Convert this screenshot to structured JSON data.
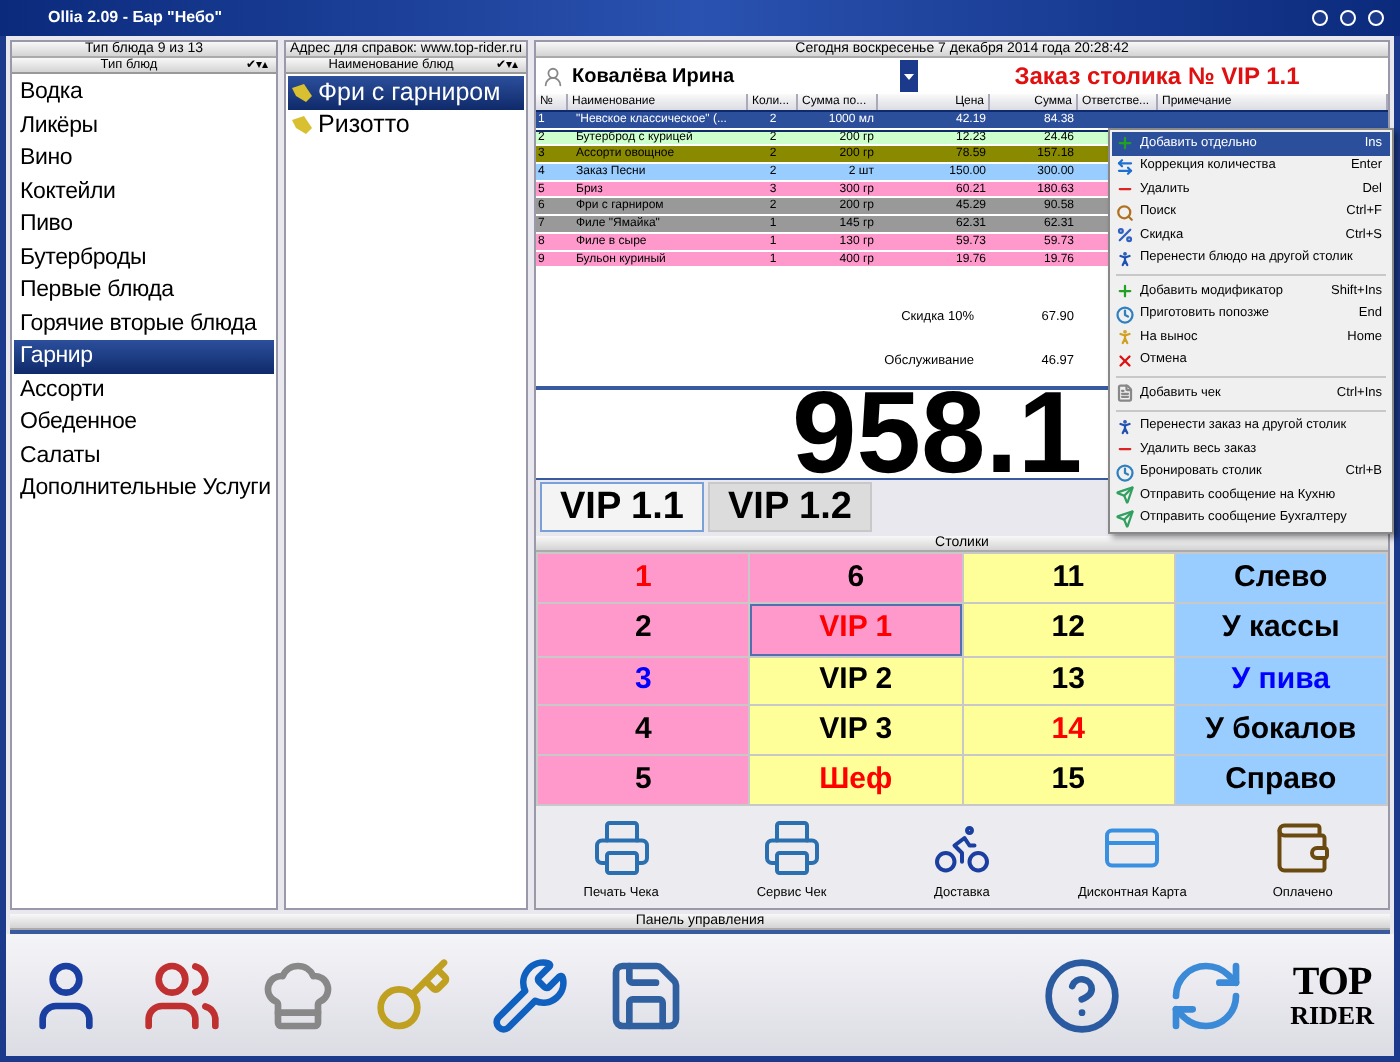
{
  "window": {
    "title": "Ollia 2.09 - Бар \"Небо\""
  },
  "dish_types": {
    "caption": "Тип блюда 9 из 13",
    "header": "Тип блюд",
    "header_marks": "✔▾▴",
    "items": [
      {
        "label": "Водка",
        "selected": false
      },
      {
        "label": "Ликёры",
        "selected": false
      },
      {
        "label": "Вино",
        "selected": false
      },
      {
        "label": "Коктейли",
        "selected": false
      },
      {
        "label": "Пиво",
        "selected": false
      },
      {
        "label": "Бутерброды",
        "selected": false
      },
      {
        "label": "Первые блюда",
        "selected": false
      },
      {
        "label": "Горячие вторые блюда",
        "selected": false
      },
      {
        "label": "Гарнир",
        "selected": true
      },
      {
        "label": "Ассорти",
        "selected": false
      },
      {
        "label": "Обеденное",
        "selected": false
      },
      {
        "label": "Салаты",
        "selected": false
      },
      {
        "label": "Дополнительные Услуги",
        "selected": false
      }
    ]
  },
  "dishes": {
    "caption": "Адрес для справок: www.top-rider.ru",
    "header": "Наименование блюд",
    "header_marks": "✔▾▴",
    "items": [
      {
        "label": "Фри с гарниром",
        "selected": true
      },
      {
        "label": "Ризотто",
        "selected": false
      }
    ]
  },
  "date_line": "Сегодня  воскресенье  7 декабря 2014 года  20:28:42",
  "customer": "Ковалёва Ирина",
  "order_title": "Заказ столика № VIP 1.1",
  "order_table": {
    "columns": [
      "№",
      "Наименование",
      "Коли...",
      "Сумма по...",
      "Цена",
      "Сумма",
      "Ответстве...",
      "Примечание"
    ],
    "rows": [
      {
        "cells": [
          "1",
          "\"Невское классическое\" (...",
          "2",
          "1000 мл",
          "42.19",
          "84.38"
        ],
        "color": "#2c4f9c",
        "selected": true
      },
      {
        "cells": [
          "2",
          "Бутерброд с курицей",
          "2",
          "200 гр",
          "12.23",
          "24.46"
        ],
        "color": "#ccffcc",
        "selected": false
      },
      {
        "cells": [
          "3",
          "Ассорти овощное",
          "2",
          "200 гр",
          "78.59",
          "157.18"
        ],
        "color": "#8a8a00",
        "selected": false
      },
      {
        "cells": [
          "4",
          "Заказ Песни",
          "2",
          "2 шт",
          "150.00",
          "300.00"
        ],
        "color": "#99ccff",
        "selected": false
      },
      {
        "cells": [
          "5",
          "Бриз",
          "3",
          "300 гр",
          "60.21",
          "180.63"
        ],
        "color": "#ff99cc",
        "selected": false
      },
      {
        "cells": [
          "6",
          "Фри с гарниром",
          "2",
          "200 гр",
          "45.29",
          "90.58"
        ],
        "color": "#999999",
        "selected": false
      },
      {
        "cells": [
          "7",
          "Филе \"Ямайка\"",
          "1",
          "145 гр",
          "62.31",
          "62.31"
        ],
        "color": "#999999",
        "selected": false
      },
      {
        "cells": [
          "8",
          "Филе в сыре",
          "1",
          "130 гр",
          "59.73",
          "59.73"
        ],
        "color": "#ff99cc",
        "selected": false
      },
      {
        "cells": [
          "9",
          "Бульон куриный",
          "1",
          "400 гр",
          "19.76",
          "19.76"
        ],
        "color": "#ff99cc",
        "selected": false
      }
    ],
    "summary": [
      {
        "label": "Скидка  10%",
        "value": "67.90"
      },
      {
        "label": "Обслуживание",
        "value": "46.97"
      }
    ]
  },
  "total": "958.1",
  "order_tabs": [
    {
      "label": "VIP 1.1",
      "selected": true
    },
    {
      "label": "VIP 1.2",
      "selected": false
    }
  ],
  "tables_caption": "Столики",
  "tables": [
    {
      "label": "1",
      "color": "#ff99cc",
      "kind": "red",
      "selected": false
    },
    {
      "label": "6",
      "color": "#ff99cc",
      "kind": "plain",
      "selected": false
    },
    {
      "label": "11",
      "color": "#ffff99",
      "kind": "plain",
      "selected": false
    },
    {
      "label": "Слево",
      "color": "#99ccff",
      "kind": "plain",
      "selected": false
    },
    {
      "label": "2",
      "color": "#ff99cc",
      "kind": "plain",
      "selected": false
    },
    {
      "label": "VIP 1",
      "color": "#ff99cc",
      "kind": "red",
      "selected": true
    },
    {
      "label": "12",
      "color": "#ffff99",
      "kind": "plain",
      "selected": false
    },
    {
      "label": "У кассы",
      "color": "#99ccff",
      "kind": "plain",
      "selected": false
    },
    {
      "label": "3",
      "color": "#ff99cc",
      "kind": "blue",
      "selected": false
    },
    {
      "label": "VIP 2",
      "color": "#ffff99",
      "kind": "plain",
      "selected": false
    },
    {
      "label": "13",
      "color": "#ffff99",
      "kind": "plain",
      "selected": false
    },
    {
      "label": "У пива",
      "color": "#99ccff",
      "kind": "blue",
      "selected": false
    },
    {
      "label": "4",
      "color": "#ff99cc",
      "kind": "plain",
      "selected": false
    },
    {
      "label": "VIP 3",
      "color": "#ffff99",
      "kind": "plain",
      "selected": false
    },
    {
      "label": "14",
      "color": "#ffff99",
      "kind": "red",
      "selected": false
    },
    {
      "label": "У бокалов",
      "color": "#99ccff",
      "kind": "plain",
      "selected": false
    },
    {
      "label": "5",
      "color": "#ff99cc",
      "kind": "plain",
      "selected": false
    },
    {
      "label": "Шеф",
      "color": "#ffff99",
      "kind": "red",
      "selected": false
    },
    {
      "label": "15",
      "color": "#ffff99",
      "kind": "plain",
      "selected": false
    },
    {
      "label": "Справо",
      "color": "#99ccff",
      "kind": "plain",
      "selected": false
    }
  ],
  "actions": [
    {
      "label": "Печать Чека"
    },
    {
      "label": "Сервис Чек"
    },
    {
      "label": "Доставка"
    },
    {
      "label": "Дисконтная Карта"
    },
    {
      "label": "Оплачено"
    }
  ],
  "context_menu": [
    {
      "kind": "item",
      "label": "Добавить отдельно",
      "shortcut": "Ins",
      "selected": true
    },
    {
      "kind": "item",
      "label": "Коррекция количества",
      "shortcut": "Enter",
      "selected": false
    },
    {
      "kind": "item",
      "label": "Удалить",
      "shortcut": "Del",
      "selected": false
    },
    {
      "kind": "item",
      "label": "Поиск",
      "shortcut": "Ctrl+F",
      "selected": false
    },
    {
      "kind": "item",
      "label": "Скидка",
      "shortcut": "Ctrl+S",
      "selected": false
    },
    {
      "kind": "item",
      "label": "Перенести блюдо на другой столик",
      "selected": false
    },
    {
      "kind": "separator"
    },
    {
      "kind": "item",
      "label": "Добавить модификатор",
      "shortcut": "Shift+Ins",
      "selected": false
    },
    {
      "kind": "item",
      "label": "Приготовить попозже",
      "shortcut": "End",
      "selected": false
    },
    {
      "kind": "item",
      "label": "На вынос",
      "shortcut": "Home",
      "selected": false
    },
    {
      "kind": "item",
      "label": "Отмена",
      "selected": false
    },
    {
      "kind": "separator"
    },
    {
      "kind": "item",
      "label": "Добавить чек",
      "shortcut": "Ctrl+Ins",
      "selected": false
    },
    {
      "kind": "separator"
    },
    {
      "kind": "item",
      "label": "Перенести заказ на другой столик",
      "selected": false
    },
    {
      "kind": "item",
      "label": "Удалить весь заказ",
      "selected": false
    },
    {
      "kind": "item",
      "label": "Бронировать столик",
      "shortcut": "Ctrl+B",
      "selected": false
    },
    {
      "kind": "item",
      "label": "Отправить сообщение на Кухню",
      "selected": false
    },
    {
      "kind": "item",
      "label": "Отправить сообщение Бухгалтеру",
      "selected": false
    }
  ],
  "control_panel": {
    "caption": "Панель управления",
    "logo_top": "TOP",
    "logo_bottom": "RIDER"
  }
}
